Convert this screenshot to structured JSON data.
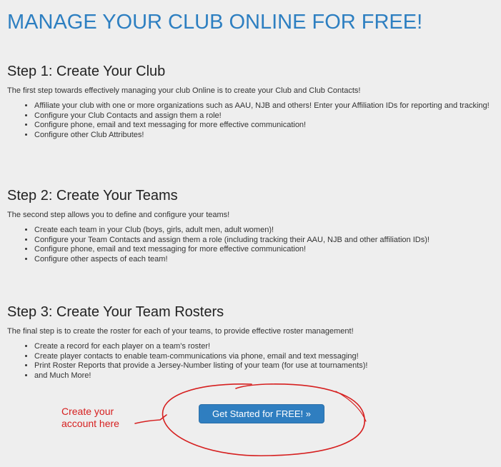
{
  "title": "MANAGE YOUR CLUB ONLINE FOR FREE!",
  "steps": [
    {
      "heading": "Step 1: Create Your Club",
      "intro": "The first step towards effectively managing your club Online is to create your Club and Club Contacts!",
      "items": [
        "Affiliate your club with one or more organizations such as AAU, NJB and others! Enter your Affiliation IDs for reporting and tracking!",
        "Configure your Club Contacts and assign them a role!",
        "Configure phone, email and text messaging for more effective communication!",
        "Configure other Club Attributes!"
      ]
    },
    {
      "heading": "Step 2: Create Your Teams",
      "intro": "The second step allows you to define and configure your teams!",
      "items": [
        "Create each team in your Club (boys, girls, adult men, adult women)!",
        "Configure your Team Contacts and assign them a role (including tracking their AAU, NJB and other affiliation IDs)!",
        "Configure phone, email and text messaging for more effective communication!",
        "Configure other aspects of each team!"
      ]
    },
    {
      "heading": "Step 3: Create Your Team Rosters",
      "intro": "The final step is to create the roster for each of your teams, to provide effective roster management!",
      "items": [
        "Create a record for each player on a team's roster!",
        "Create player contacts to enable team-communications via phone, email and text messaging!",
        "Print Roster Reports that provide a Jersey-Number listing of your team (for use at tournaments)!",
        "and Much More!"
      ]
    }
  ],
  "cta_label": "Get Started for FREE! »",
  "annotation": {
    "line1": "Create your",
    "line2": "account here",
    "color": "#d61f1f"
  },
  "colors": {
    "title": "#2d7fc1",
    "button": "#2f7ec0",
    "background": "#eeeeee"
  }
}
